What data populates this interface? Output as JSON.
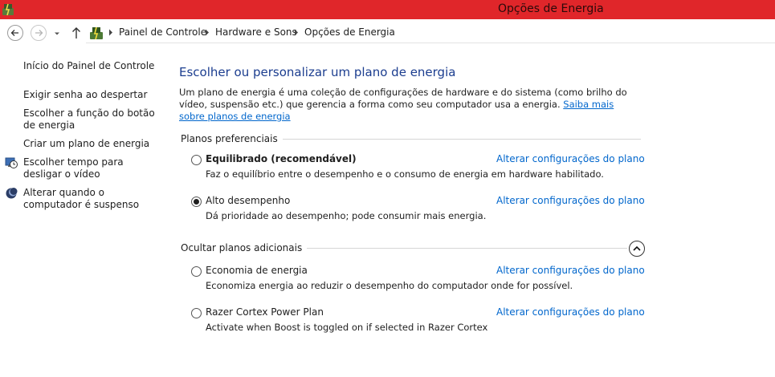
{
  "window": {
    "title": "Opções de Energia"
  },
  "breadcrumb": [
    "Painel de Controle",
    "Hardware e Sons",
    "Opções de Energia"
  ],
  "sidebar": {
    "items": [
      {
        "label": "Início do Painel de Controle"
      },
      {
        "label": "Exigir senha ao despertar"
      },
      {
        "label": "Escolher a função do botão de energia"
      },
      {
        "label": "Criar um plano de energia"
      },
      {
        "label": "Escolher tempo para desligar o vídeo",
        "icon": "clock-monitor-icon"
      },
      {
        "label": "Alterar quando o computador é suspenso",
        "icon": "moon-icon"
      }
    ]
  },
  "main": {
    "title": "Escolher ou personalizar um plano de energia",
    "description": "Um plano de energia é uma coleção de configurações de hardware e do sistema (como brilho do vídeo, suspensão etc.) que gerencia a forma como seu computador usa a energia. ",
    "learn_more": "Saiba mais sobre planos de energia",
    "preferred_label": "Planos preferenciais",
    "additional_label": "Ocultar planos adicionais",
    "change_label": "Alterar configurações do plano",
    "preferred_plans": [
      {
        "name": "Equilibrado (recomendável)",
        "desc": "Faz o equilíbrio entre o desempenho e o consumo de energia em hardware habilitado.",
        "selected": false
      },
      {
        "name": "Alto desempenho",
        "desc": "Dá prioridade ao desempenho; pode consumir mais energia.",
        "selected": true
      }
    ],
    "additional_plans": [
      {
        "name": "Economia de energia",
        "desc": "Economiza energia ao reduzir o desempenho do computador onde for possível.",
        "selected": false
      },
      {
        "name": "Razer Cortex Power Plan",
        "desc": "Activate when Boost is toggled on if selected in Razer Cortex",
        "selected": false
      }
    ]
  },
  "colors": {
    "titlebar": "#e0262a",
    "link": "#0066cc",
    "heading": "#1b3d8f"
  }
}
